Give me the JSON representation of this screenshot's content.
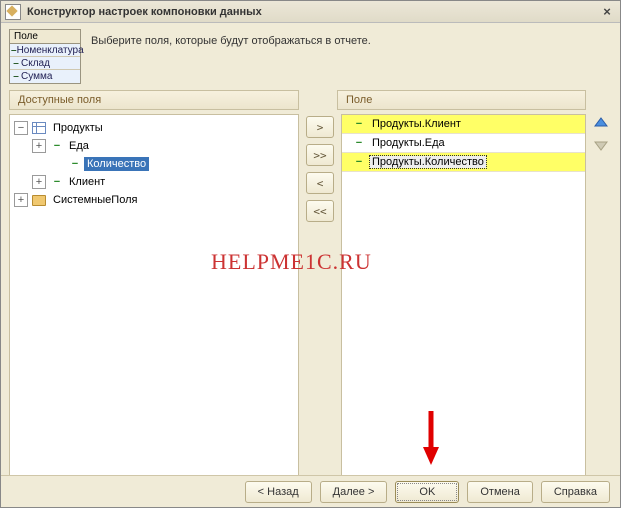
{
  "window": {
    "title": "Конструктор настроек компоновки данных",
    "close": "×"
  },
  "mini": {
    "header": "Поле",
    "rows": [
      "Номенклатура",
      "Склад",
      "Сумма"
    ]
  },
  "instruction": "Выберите поля, которые будут отображаться в отчете.",
  "columns": {
    "available": "Доступные поля",
    "selected": "Поле"
  },
  "tree": {
    "root": {
      "label": "Продукты"
    },
    "items": [
      {
        "label": "Еда"
      },
      {
        "label": "Количество"
      },
      {
        "label": "Клиент"
      }
    ],
    "system": {
      "label": "СистемныеПоля"
    }
  },
  "xfer": {
    "one_r": ">",
    "all_r": ">>",
    "one_l": "<",
    "all_l": "<<"
  },
  "selected": [
    {
      "label": "Продукты.Клиент"
    },
    {
      "label": "Продукты.Еда"
    },
    {
      "label": "Продукты.Количество"
    }
  ],
  "watermark": "HELPME1C.RU",
  "buttons": {
    "back": "< Назад",
    "next": "Далее >",
    "ok": "OK",
    "cancel": "Отмена",
    "help": "Справка"
  }
}
